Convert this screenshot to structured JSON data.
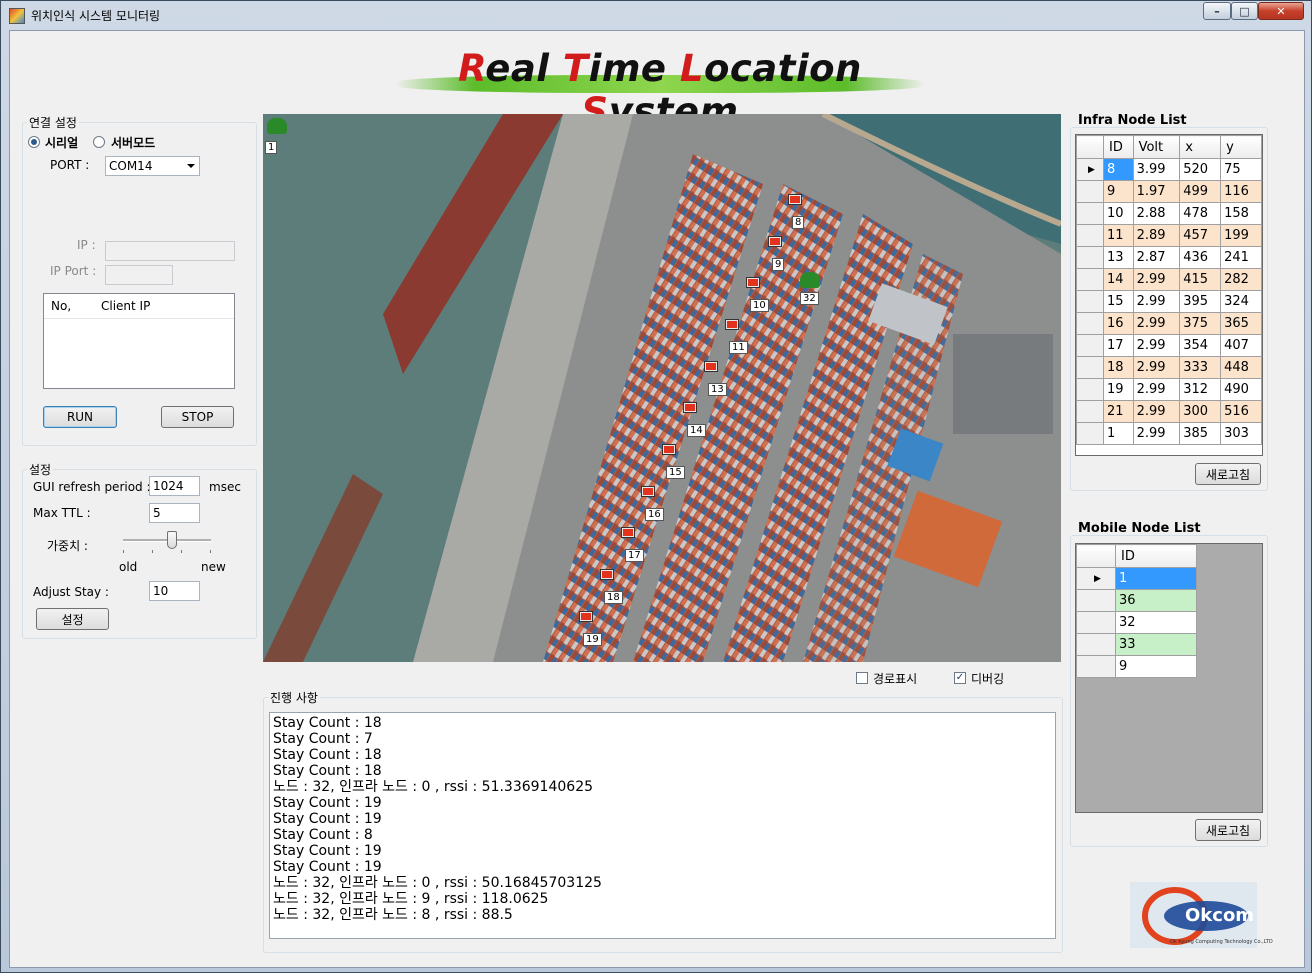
{
  "window": {
    "title": "위치인식 시스템 모니터링"
  },
  "logo": {
    "parts": [
      [
        "R",
        "eal "
      ],
      [
        "T",
        "ime "
      ],
      [
        "L",
        "ocation "
      ],
      [
        "S",
        "ystem"
      ]
    ]
  },
  "connection": {
    "legend": "연결 설정",
    "serial_label": "시리얼",
    "server_label": "서버모드",
    "port_label": "PORT :",
    "port_value": "COM14",
    "ip_label": "IP :",
    "ip_value": "",
    "ip_port_label": "IP Port :",
    "ip_port_value": "",
    "client_cols": [
      "No,",
      "Client IP"
    ],
    "run_label": "RUN",
    "stop_label": "STOP"
  },
  "settings": {
    "legend": "설정",
    "refresh_label": "GUI refresh period :",
    "refresh_value": "1024",
    "refresh_unit": "msec",
    "ttl_label": "Max TTL  :",
    "ttl_value": "5",
    "weight_label": "가중치  :",
    "weight_old": "old",
    "weight_new": "new",
    "weight_level": 0.55,
    "adjust_label": "Adjust Stay :",
    "adjust_value": "10",
    "apply_label": "설정"
  },
  "map": {
    "corner_label": "1",
    "mobile_label": "32",
    "flags": [
      "8",
      "9",
      "10",
      "11",
      "13",
      "14",
      "15",
      "16",
      "17",
      "18",
      "19"
    ]
  },
  "options": {
    "path_label": "경로표시",
    "path_checked": false,
    "debug_label": "디버깅",
    "debug_checked": true
  },
  "progress": {
    "legend": "진행 사항",
    "lines": [
      "Stay Count : 18",
      "Stay Count : 7",
      "Stay Count : 18",
      "Stay Count : 18",
      "노드 : 32, 인프라 노드 : 0 , rssi : 51.3369140625",
      "Stay Count : 19",
      "Stay Count : 19",
      "Stay Count : 8",
      "Stay Count : 19",
      "Stay Count : 19",
      "노드 : 32, 인프라 노드 : 0 , rssi : 50.16845703125",
      "노드 : 32, 인프라 노드 : 9 , rssi : 118.0625",
      "노드 : 32, 인프라 노드 : 8 , rssi : 88.5"
    ]
  },
  "infra": {
    "title": "Infra Node List",
    "columns": [
      "ID",
      "Volt",
      "x",
      "y"
    ],
    "rows": [
      [
        "8",
        "3.99",
        "520",
        "75"
      ],
      [
        "9",
        "1.97",
        "499",
        "116"
      ],
      [
        "10",
        "2.88",
        "478",
        "158"
      ],
      [
        "11",
        "2.89",
        "457",
        "199"
      ],
      [
        "13",
        "2.87",
        "436",
        "241"
      ],
      [
        "14",
        "2.99",
        "415",
        "282"
      ],
      [
        "15",
        "2.99",
        "395",
        "324"
      ],
      [
        "16",
        "2.99",
        "375",
        "365"
      ],
      [
        "17",
        "2.99",
        "354",
        "407"
      ],
      [
        "18",
        "2.99",
        "333",
        "448"
      ],
      [
        "19",
        "2.99",
        "312",
        "490"
      ],
      [
        "21",
        "2.99",
        "300",
        "516"
      ],
      [
        "1",
        "2.99",
        "385",
        "303"
      ]
    ],
    "refresh_label": "새로고침"
  },
  "mobile": {
    "title": "Mobile Node List",
    "columns": [
      "ID"
    ],
    "rows": [
      "1",
      "36",
      "32",
      "33",
      "9"
    ],
    "refresh_label": "새로고침"
  },
  "brand": {
    "text": "Okcom",
    "sub": "Ok Kyung Computing Technology Co.,LTD"
  },
  "colors": {
    "row_alt": "#fce4cc",
    "mobile_alt": "#c8f0c8",
    "selected": "#3399ff",
    "flag": "#e3321d"
  }
}
